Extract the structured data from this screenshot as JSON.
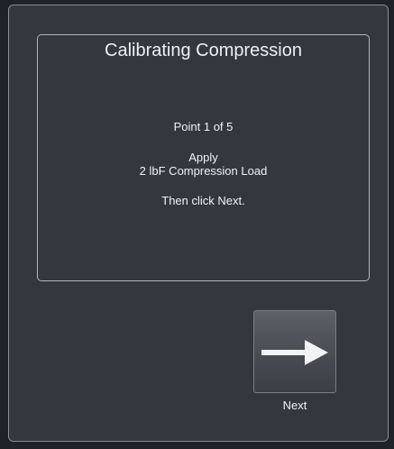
{
  "dialog": {
    "title": "Calibrating Compression",
    "point_text": "Point 1 of 5",
    "apply_text": "Apply",
    "load_text": "2 lbF Compression Load",
    "instruction_text": "Then click Next."
  },
  "next_button": {
    "label": "Next",
    "icon": "arrow-right-icon"
  },
  "colors": {
    "background": "#34373d",
    "text": "#f2f3f5",
    "border": "#b4b7bc"
  }
}
